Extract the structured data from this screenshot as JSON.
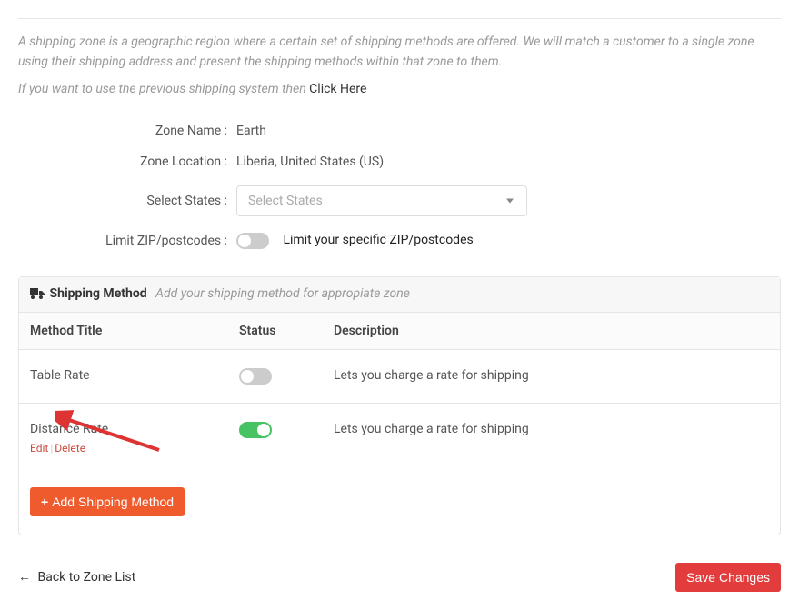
{
  "intro": {
    "line1": "A shipping zone is a geographic region where a certain set of shipping methods are offered. We will match a customer to a single zone using their shipping address and present the shipping methods within that zone to them.",
    "line2_prefix": "If you want to use the previous shipping system then ",
    "line2_link": "Click Here"
  },
  "form": {
    "zone_name_label": "Zone Name :",
    "zone_name_value": "Earth",
    "zone_location_label": "Zone Location :",
    "zone_location_value": "Liberia, United States (US)",
    "select_states_label": "Select States :",
    "select_states_placeholder": "Select States",
    "limit_zip_label": "Limit ZIP/postcodes :",
    "limit_zip_text": "Limit your specific ZIP/postcodes"
  },
  "shipping": {
    "header_title": "Shipping Method",
    "header_subtitle": "Add your shipping method for appropiate zone",
    "columns": {
      "title": "Method Title",
      "status": "Status",
      "description": "Description"
    },
    "rows": [
      {
        "title": "Table Rate",
        "status_on": false,
        "description": "Lets you charge a rate for shipping",
        "show_actions": false
      },
      {
        "title": "Distance Rate",
        "status_on": true,
        "description": "Lets you charge a rate for shipping",
        "show_actions": true
      }
    ],
    "actions": {
      "edit": "Edit",
      "delete": "Delete"
    },
    "add_button": "Add Shipping Method"
  },
  "footer": {
    "back_text": "Back to Zone List",
    "save_text": "Save Changes"
  }
}
